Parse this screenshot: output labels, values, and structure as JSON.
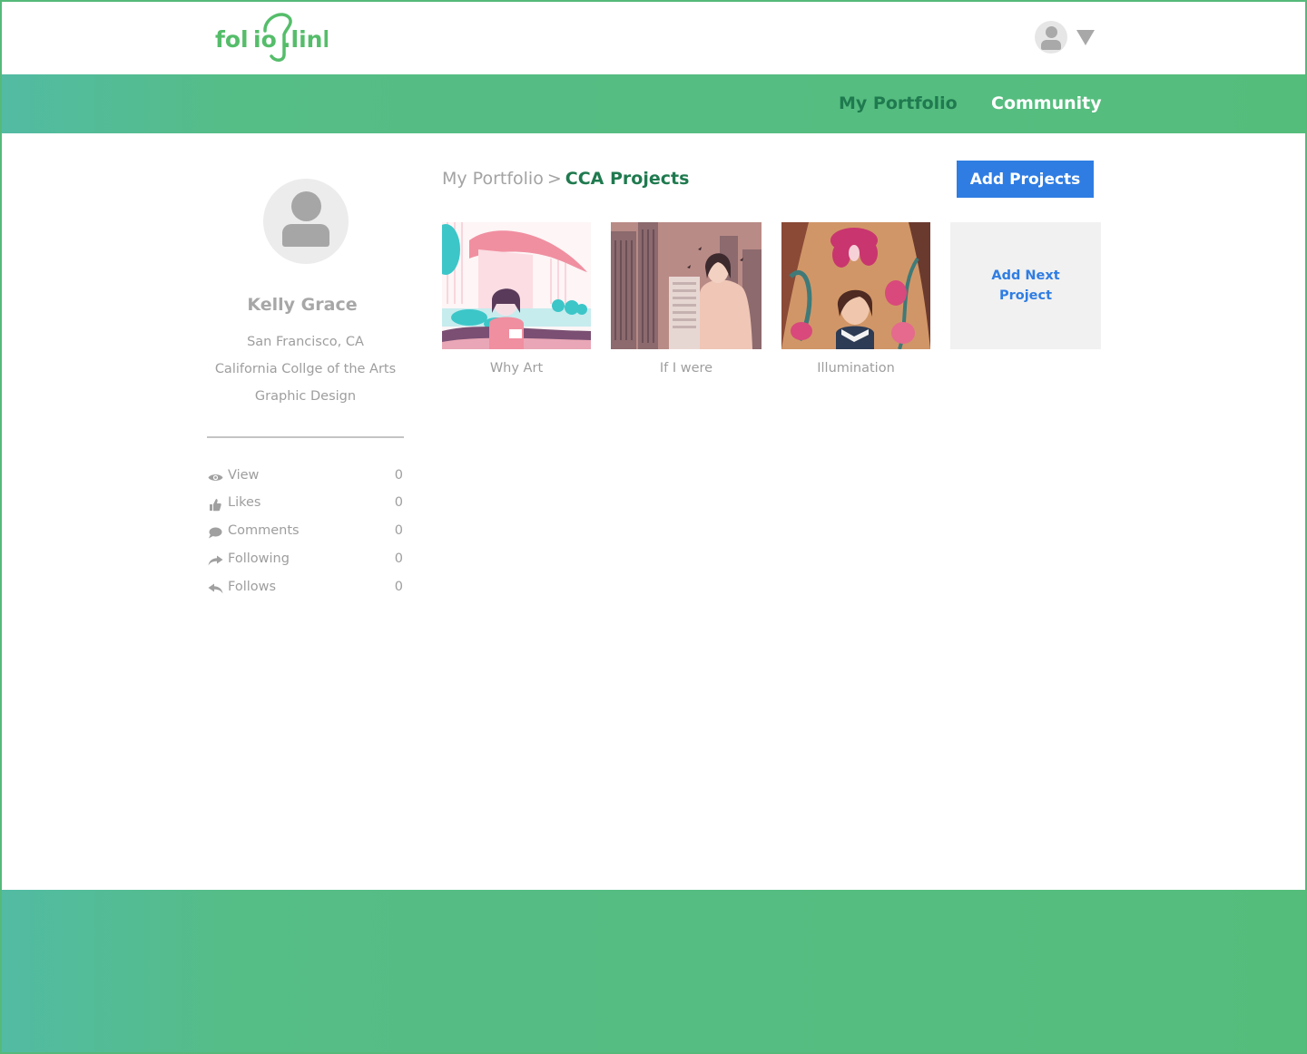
{
  "brand": {
    "logo_text": "folio.link",
    "green": "#55bd7c",
    "dark_green": "#1f7a4f",
    "accent_blue": "#2f7de3"
  },
  "header": {
    "user_avatar_icon": "user-avatar-icon",
    "menu_caret_icon": "caret-down-icon"
  },
  "nav": {
    "my_portfolio": "My Portfolio",
    "community": "Community"
  },
  "profile": {
    "name": "Kelly Grace",
    "location": "San Francisco, CA",
    "school": "California Collge of the Arts",
    "major": "Graphic Design"
  },
  "stats": [
    {
      "label": "View",
      "value": "0",
      "icon": "eye-icon"
    },
    {
      "label": "Likes",
      "value": "0",
      "icon": "thumbs-up-icon"
    },
    {
      "label": "Comments",
      "value": "0",
      "icon": "comment-icon"
    },
    {
      "label": "Following",
      "value": "0",
      "icon": "share-arrow-icon"
    },
    {
      "label": "Follows",
      "value": "0",
      "icon": "reply-arrow-icon"
    }
  ],
  "breadcrumb": {
    "root": "My Portfolio",
    "separator": ">",
    "current": "CCA Projects"
  },
  "actions": {
    "add_projects": "Add Projects",
    "add_next_project": "Add Next Project"
  },
  "projects": [
    {
      "title": "Why Art"
    },
    {
      "title": "If I were"
    },
    {
      "title": "Illumination"
    }
  ]
}
